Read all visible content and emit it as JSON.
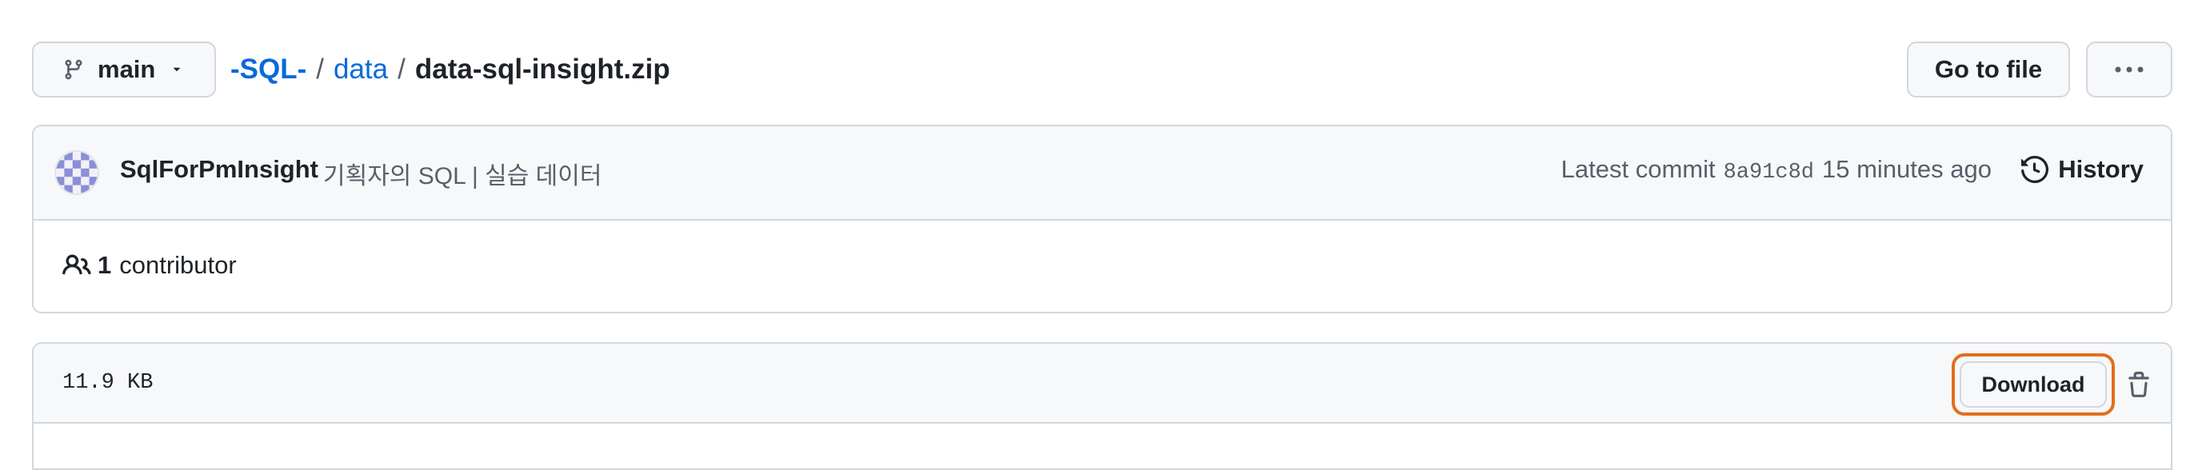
{
  "branch": {
    "label": "main",
    "icon": "git-branch-icon"
  },
  "breadcrumb": {
    "repo": "-SQL-",
    "separator1": "/",
    "folder": "data",
    "separator2": "/",
    "file": "data-sql-insight.zip"
  },
  "actions": {
    "goto_file": "Go to file",
    "more_icon": "kebab-horizontal-icon"
  },
  "commit": {
    "author": "SqlForPmInsight",
    "message": "기획자의 SQL | 실습 데이터",
    "latest_label": "Latest commit",
    "sha": "8a91c8d",
    "time": "15 minutes ago",
    "history_label": "History"
  },
  "contributors": {
    "count": "1",
    "label": "contributor"
  },
  "file": {
    "size": "11.9 KB",
    "download_label": "Download"
  },
  "colors": {
    "link": "#0969da",
    "highlight_ring": "#e36e1c",
    "border": "#d0d7de",
    "header_bg": "#f6f8fa"
  }
}
